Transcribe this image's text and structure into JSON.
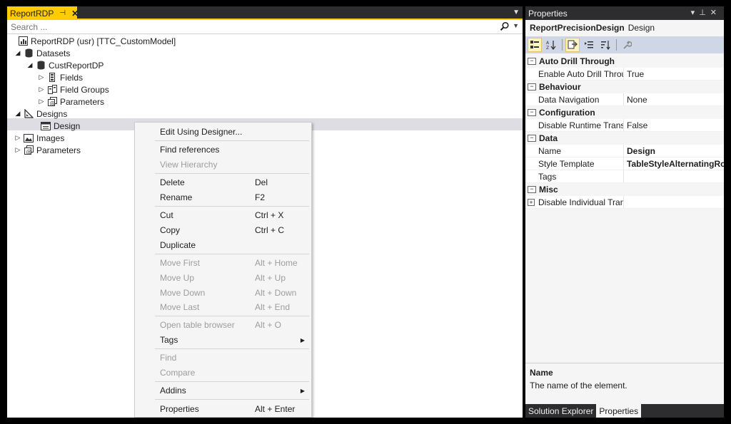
{
  "doc": {
    "tab_title": "ReportRDP",
    "pin_glyph": "⊣",
    "close_glyph": "✕",
    "search_placeholder": "Search ..."
  },
  "tree": {
    "root": "ReportRDP (usr) [TTC_CustomModel]",
    "datasets": "Datasets",
    "custreportdp": "CustReportDP",
    "fields": "Fields",
    "field_groups": "Field Groups",
    "ds_parameters": "Parameters",
    "designs": "Designs",
    "design": "Design",
    "images": "Images",
    "parameters": "Parameters"
  },
  "context_menu": {
    "edit_using_designer": "Edit Using Designer...",
    "find_references": "Find references",
    "view_hierarchy": "View Hierarchy",
    "delete": "Delete",
    "delete_sc": "Del",
    "rename": "Rename",
    "rename_sc": "F2",
    "cut": "Cut",
    "cut_sc": "Ctrl + X",
    "copy": "Copy",
    "copy_sc": "Ctrl + C",
    "duplicate": "Duplicate",
    "move_first": "Move First",
    "move_first_sc": "Alt + Home",
    "move_up": "Move Up",
    "move_up_sc": "Alt + Up",
    "move_down": "Move Down",
    "move_down_sc": "Alt + Down",
    "move_last": "Move Last",
    "move_last_sc": "Alt + End",
    "open_table_browser": "Open table browser",
    "open_table_browser_sc": "Alt + O",
    "tags": "Tags",
    "find": "Find",
    "compare": "Compare",
    "addins": "Addins",
    "properties": "Properties",
    "properties_sc": "Alt + Enter"
  },
  "properties": {
    "title": "Properties",
    "object_name": "ReportPrecisionDesign",
    "object_type": "Design",
    "categories": {
      "auto_drill": "Auto Drill Through",
      "behaviour": "Behaviour",
      "configuration": "Configuration",
      "data": "Data",
      "misc": "Misc"
    },
    "rows": {
      "enable_auto_drill": {
        "name": "Enable Auto Drill Throug",
        "value": "True"
      },
      "data_navigation": {
        "name": "Data Navigation",
        "value": "None"
      },
      "disable_runtime": {
        "name": "Disable Runtime Transfo",
        "value": "False"
      },
      "name": {
        "name": "Name",
        "value": "Design"
      },
      "style_template": {
        "name": "Style Template",
        "value": "TableStyleAlternatingRow"
      },
      "tags": {
        "name": "Tags",
        "value": ""
      },
      "disable_individual": {
        "name": "Disable Individual Transf",
        "value": ""
      }
    },
    "description_title": "Name",
    "description_text": "The name of the element.",
    "tab_solution_explorer": "Solution Explorer",
    "tab_properties": "Properties"
  },
  "colors": {
    "accent": "#ffcc00",
    "chrome": "#2d2d30",
    "toolbar": "#cfd6e5"
  }
}
